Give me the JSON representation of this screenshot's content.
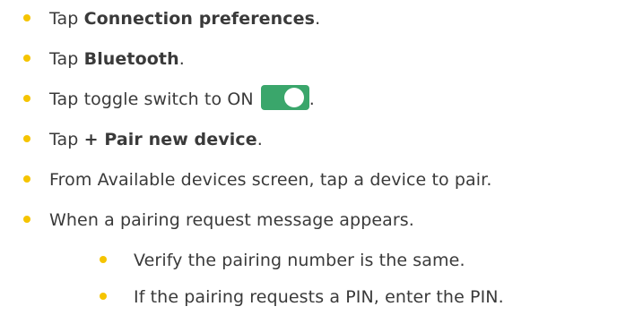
{
  "colors": {
    "bullet": "#f5c400",
    "text": "#3a3a3a",
    "toggle_on": "#3aa66b"
  },
  "steps": [
    {
      "prefix": "Tap ",
      "bold": "Connection preferences",
      "suffix": "."
    },
    {
      "prefix": "Tap ",
      "bold": "Bluetooth",
      "suffix": "."
    },
    {
      "prefix": "Tap toggle switch to ON",
      "toggle_state": "ON",
      "suffix": "."
    },
    {
      "prefix": "Tap ",
      "bold": "+ Pair new device",
      "suffix": "."
    },
    {
      "text": "From Available devices screen, tap a device to pair."
    },
    {
      "text": "When a pairing request message appears."
    }
  ],
  "substeps": [
    {
      "text": "Verify the pairing number is the same."
    },
    {
      "text": "If the pairing requests a PIN, enter the PIN."
    }
  ]
}
